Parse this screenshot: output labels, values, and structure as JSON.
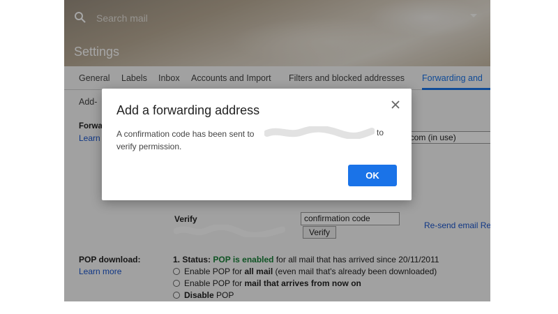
{
  "header": {
    "search_placeholder": "Search mail",
    "title": "Settings"
  },
  "tabs": [
    {
      "label": "General"
    },
    {
      "label": "Labels"
    },
    {
      "label": "Inbox"
    },
    {
      "label": "Accounts and Import"
    },
    {
      "label": "Filters and blocked addresses"
    },
    {
      "label": "Forwarding and"
    }
  ],
  "addons_tab": "Add-",
  "forwarding": {
    "label": "Forwa",
    "learn_more": "Learn",
    "selected_address": "il.com (in use)"
  },
  "verify": {
    "label": "Verify",
    "code_placeholder": "confirmation code",
    "button": "Verify",
    "resend": "Re-send email Re"
  },
  "pop": {
    "label": "POP download:",
    "learn_more": "Learn more",
    "status_prefix": "1. Status: ",
    "status_value": "POP is enabled",
    "status_suffix": " for all mail that has arrived since 20/11/2011",
    "options": [
      {
        "pre": "Enable POP for ",
        "bold": "all mail",
        "post": " (even mail that's already been downloaded)"
      },
      {
        "pre": "Enable POP for ",
        "bold": "mail that arrives from now on",
        "post": ""
      },
      {
        "pre": "",
        "bold": "Disable",
        "post": " POP"
      }
    ]
  },
  "dialog": {
    "title": "Add a forwarding address",
    "message_start": "A confirmation code has been sent to",
    "message_end": "to",
    "message_line2": "verify permission.",
    "ok_label": "OK"
  },
  "colors": {
    "accent": "#1a73e8",
    "pop_enabled": "#188038",
    "link": "#1a55cc"
  }
}
